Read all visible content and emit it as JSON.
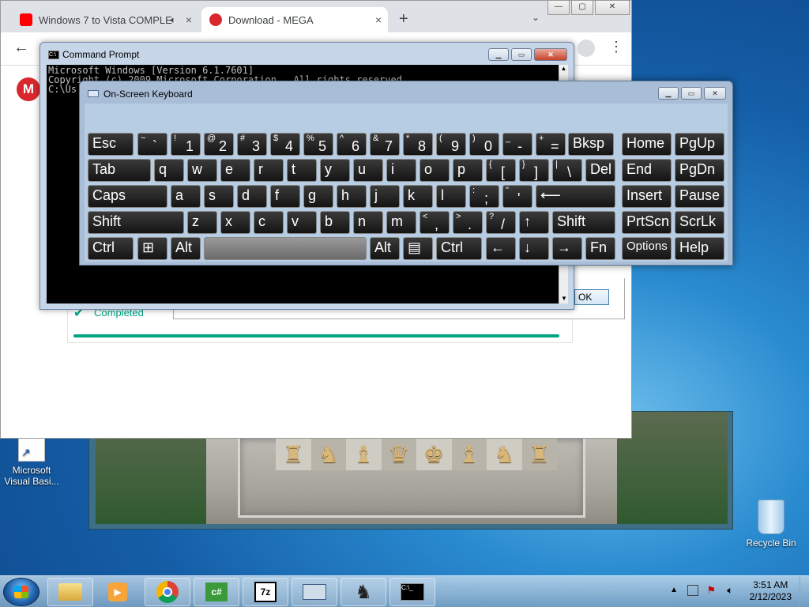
{
  "desktop": {
    "icons": [
      {
        "label": "Microsoft Visual Basi..."
      },
      {
        "label": "Recycle Bin"
      }
    ]
  },
  "chrome": {
    "tabs": [
      {
        "title": "Windows 7 to Vista COMPLE"
      },
      {
        "title": "Download - MEGA"
      }
    ],
    "new_tab": "+",
    "close": "×",
    "status": "Completed",
    "ok_label": "OK",
    "progress": 1.0,
    "brand_color": "#d9272e",
    "accent_color": "#00a382"
  },
  "cmd": {
    "title": "Command Prompt",
    "lines": [
      "Microsoft Windows [Version 6.1.7601]",
      "Copyright (c) 2009 Microsoft Corporation.  All rights reserved.",
      "",
      "C:\\Us"
    ]
  },
  "osk": {
    "title": "On-Screen Keyboard",
    "keys": {
      "esc": "Esc",
      "tab": "Tab",
      "caps": "Caps",
      "shift": "Shift",
      "ctrl": "Ctrl",
      "alt": "Alt",
      "bksp": "Bksp",
      "del": "Del",
      "fn": "Fn",
      "home": "Home",
      "pgup": "PgUp",
      "end": "End",
      "pgdn": "PgDn",
      "insert": "Insert",
      "pause": "Pause",
      "prtscn": "PrtScn",
      "scrlk": "ScrLk",
      "options": "Options",
      "help": "Help",
      "row1": [
        [
          "~",
          "`"
        ],
        [
          "!",
          "1"
        ],
        [
          "@",
          "2"
        ],
        [
          "#",
          "3"
        ],
        [
          "$",
          "4"
        ],
        [
          "%",
          "5"
        ],
        [
          "^",
          "6"
        ],
        [
          "&",
          "7"
        ],
        [
          "*",
          "8"
        ],
        [
          "(",
          "9"
        ],
        [
          ")",
          "0"
        ],
        [
          "_",
          "-"
        ],
        [
          "+",
          "="
        ]
      ],
      "row2": [
        "q",
        "w",
        "e",
        "r",
        "t",
        "y",
        "u",
        "i",
        "o",
        "p"
      ],
      "row2p": [
        [
          "{",
          "["
        ],
        [
          "}",
          "]"
        ],
        [
          "|",
          "\\"
        ]
      ],
      "row3": [
        "a",
        "s",
        "d",
        "f",
        "g",
        "h",
        "j",
        "k",
        "l"
      ],
      "row3p": [
        [
          ":",
          ";"
        ],
        [
          "\"",
          "'"
        ]
      ],
      "row4": [
        "z",
        "x",
        "c",
        "v",
        "b",
        "n",
        "m"
      ],
      "row4p": [
        [
          "<",
          ","
        ],
        [
          ">",
          "."
        ],
        [
          "?",
          "/"
        ]
      ]
    }
  },
  "taskbar": {
    "time": "3:51 AM",
    "date": "2/12/2023"
  }
}
